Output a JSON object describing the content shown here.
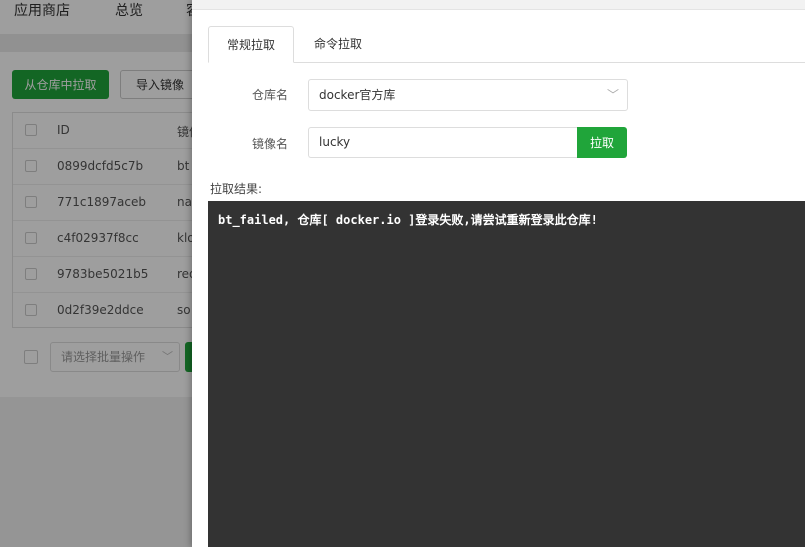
{
  "background": {
    "nav": [
      "应用商店",
      "总览",
      "容"
    ],
    "buttons": {
      "pull_from_repo": "从仓库中拉取",
      "import_image": "导入镜像"
    },
    "table": {
      "id_header": "ID",
      "image_header": "镜像",
      "rows": [
        {
          "id": "0899dcfd5c7b",
          "image": "bt"
        },
        {
          "id": "771c1897aceb",
          "image": "na"
        },
        {
          "id": "c4f02937f8cc",
          "image": "klo"
        },
        {
          "id": "9783be5021b5",
          "image": "red"
        },
        {
          "id": "0d2f39e2ddce",
          "image": "so"
        }
      ]
    },
    "batch_select_placeholder": "请选择批量操作"
  },
  "drawer": {
    "tabs": [
      "常规拉取",
      "命令拉取"
    ],
    "repo_label": "仓库名",
    "repo_value": "docker官方库",
    "image_label": "镜像名",
    "image_value": "lucky",
    "pull_button": "拉取",
    "result_label": "拉取结果:",
    "result_text": "bt_failed, 仓库[ docker.io ]登录失败,请尝试重新登录此仓库!"
  },
  "colors": {
    "accent": "#20a53a",
    "terminal_bg": "#333333"
  }
}
